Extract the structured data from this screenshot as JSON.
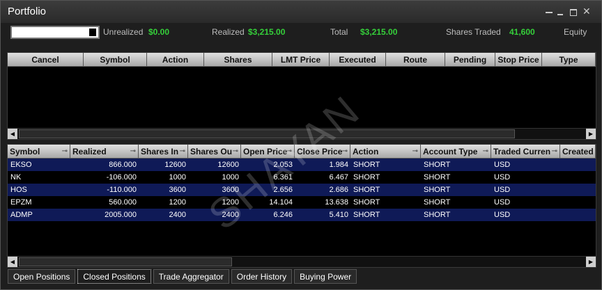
{
  "window": {
    "title": "Portfolio"
  },
  "summary": {
    "unrealized_label": "Unrealized",
    "unrealized_value": "$0.00",
    "realized_label": "Realized",
    "realized_value": "$3,215.00",
    "total_label": "Total",
    "total_value": "$3,215.00",
    "shares_traded_label": "Shares Traded",
    "shares_traded_value": "41,600",
    "equity_label": "Equity"
  },
  "orders": {
    "columns": [
      "Cancel",
      "Symbol",
      "Action",
      "Shares",
      "LMT Price",
      "Executed",
      "Route",
      "Pending",
      "Stop Price",
      "Type"
    ]
  },
  "positions": {
    "columns": [
      "Symbol",
      "Realized",
      "Shares In",
      "Shares Ou",
      "Open Price",
      "Close Price",
      "Action",
      "Account Type",
      "Traded Curren",
      "Created"
    ],
    "rows": [
      [
        "EKSO",
        "866.000",
        "12600",
        "12600",
        "2.053",
        "1.984",
        "SHORT",
        "SHORT",
        "USD"
      ],
      [
        "NK",
        "-106.000",
        "1000",
        "1000",
        "6.361",
        "6.467",
        "SHORT",
        "SHORT",
        "USD"
      ],
      [
        "HOS",
        "-110.000",
        "3600",
        "3600",
        "2.656",
        "2.686",
        "SHORT",
        "SHORT",
        "USD"
      ],
      [
        "EPZM",
        "560.000",
        "1200",
        "1200",
        "14.104",
        "13.638",
        "SHORT",
        "SHORT",
        "USD"
      ],
      [
        "ADMP",
        "2005.000",
        "2400",
        "2400",
        "6.246",
        "5.410",
        "SHORT",
        "SHORT",
        "USD"
      ]
    ]
  },
  "tabs": [
    "Open Positions",
    "Closed Positions",
    "Trade Aggregator",
    "Order History",
    "Buying Power"
  ],
  "active_tab": "Closed Positions",
  "watermark": "SHAYAN",
  "colors": {
    "positive": "#35d03a",
    "row_highlight": "#0f1a57",
    "background": "#000000"
  }
}
